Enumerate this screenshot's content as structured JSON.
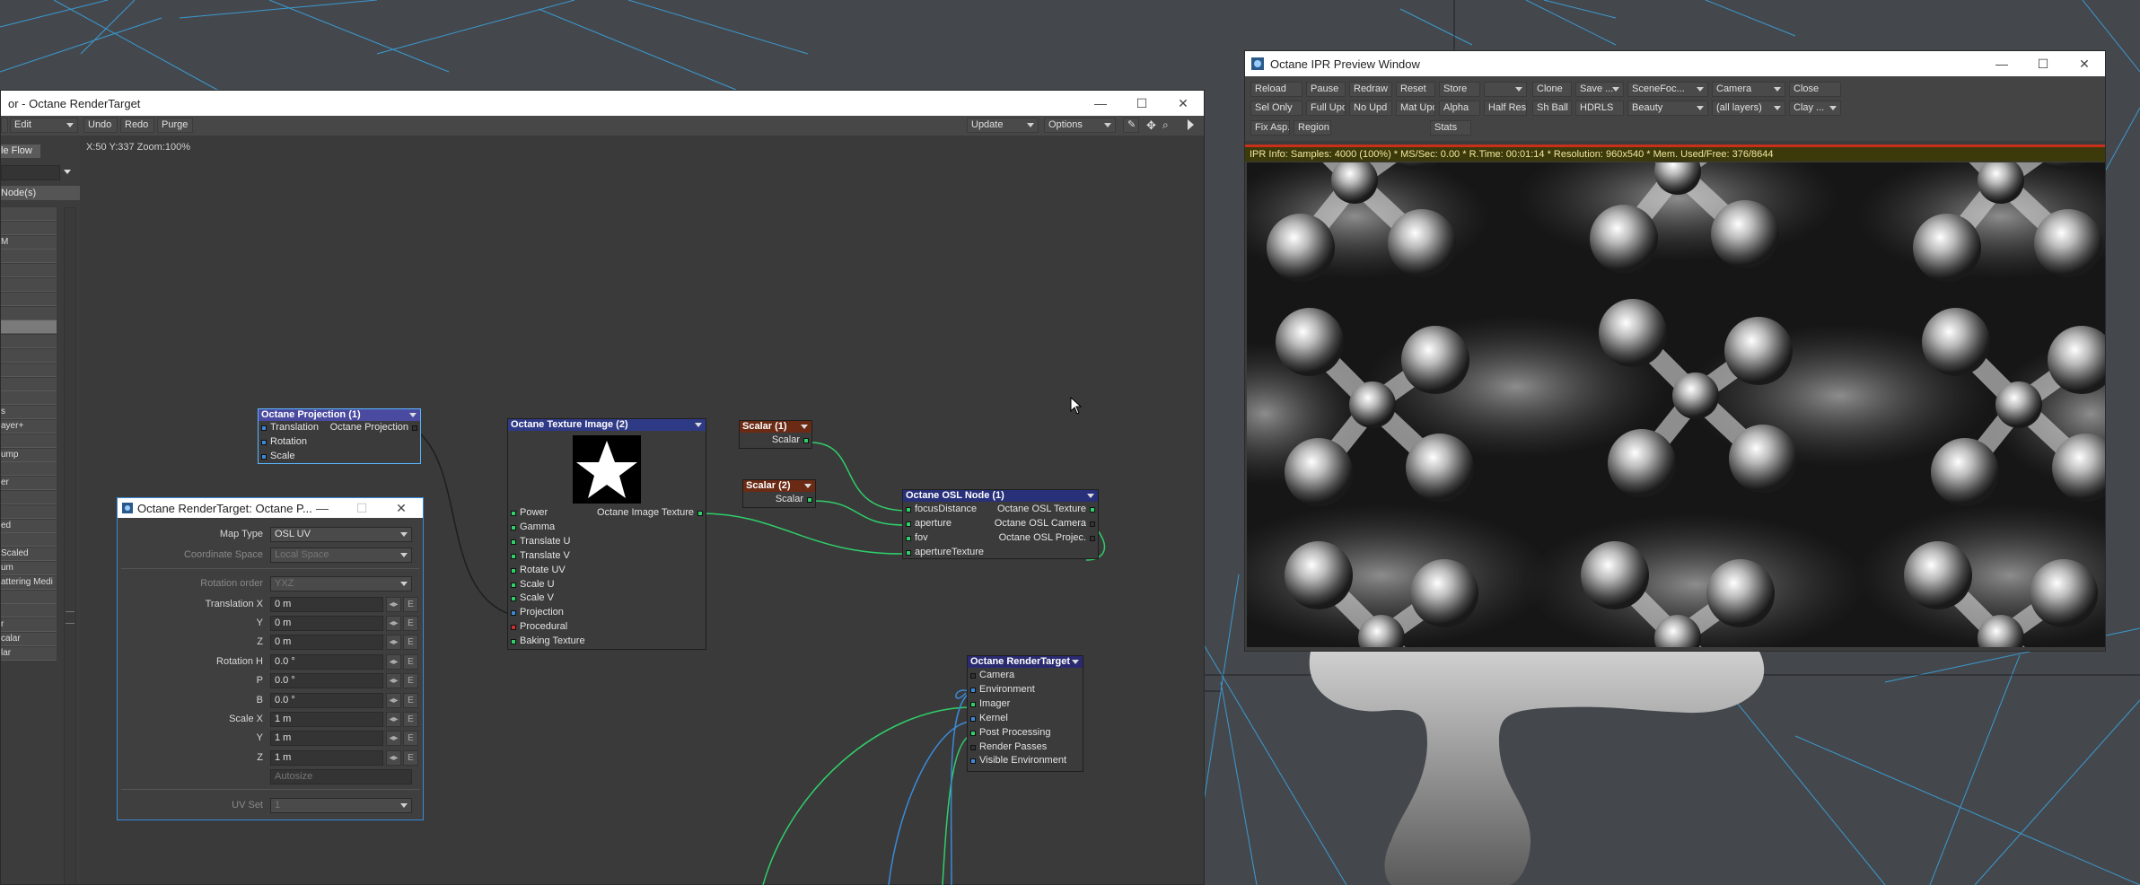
{
  "node_editor": {
    "title": "or - Octane RenderTarget",
    "menus": {
      "edit": "Edit"
    },
    "toolbar": {
      "undo": "Undo",
      "redo": "Redo",
      "purge": "Purge",
      "update": "Update",
      "options": "Options"
    },
    "status": "X:50 Y:337 Zoom:100%",
    "left_panel": {
      "tab": "le Flow",
      "header": "Node(s)",
      "items": [
        "",
        "",
        "M",
        "",
        "",
        "",
        "",
        "",
        "",
        "",
        "",
        "",
        "",
        "",
        "s",
        "ayer+",
        "",
        "ump",
        "",
        "er",
        "",
        "",
        "ed",
        "",
        "Scaled",
        "um",
        "attering Medi",
        "",
        "",
        "r",
        "calar",
        "lar"
      ]
    }
  },
  "nodes": {
    "projection": {
      "title": "Octane Projection (1)",
      "inputs": [
        "Translation",
        "Rotation",
        "Scale"
      ],
      "output": "Octane Projection"
    },
    "texture": {
      "title": "Octane Texture Image (2)",
      "inputs": [
        "Power",
        "Gamma",
        "Translate U",
        "Translate V",
        "Rotate UV",
        "Scale U",
        "Scale V",
        "Projection",
        "Procedural",
        "Baking Texture"
      ],
      "output": "Octane Image Texture"
    },
    "scalar1": {
      "title": "Scalar (1)",
      "output": "Scalar"
    },
    "scalar2": {
      "title": "Scalar (2)",
      "output": "Scalar"
    },
    "osl": {
      "title": "Octane OSL Node (1)",
      "inputs": [
        "focusDistance",
        "aperture",
        "fov",
        "apertureTexture"
      ],
      "outputs": [
        "Octane OSL Texture",
        "Octane OSL Camera",
        "Octane OSL Projec."
      ]
    },
    "rendertarget": {
      "title": "Octane RenderTarget",
      "inputs": [
        "Camera",
        "Environment",
        "Imager",
        "Kernel",
        "Post Processing",
        "Render Passes",
        "Visible Environment"
      ]
    }
  },
  "props_panel": {
    "title": "Octane RenderTarget: Octane P...",
    "fields": [
      {
        "label": "Map Type",
        "value": "OSL UV",
        "dropdown": true,
        "enabled": true
      },
      {
        "label": "Coordinate Space",
        "value": "Local Space",
        "dropdown": true,
        "enabled": false
      },
      {
        "label": "Rotation order",
        "value": "YXZ",
        "dropdown": true,
        "enabled": false
      },
      {
        "label": "Translation X",
        "value": "0 m",
        "enabled": true,
        "env": true
      },
      {
        "label": "Y",
        "value": "0 m",
        "enabled": true,
        "env": true
      },
      {
        "label": "Z",
        "value": "0 m",
        "enabled": true,
        "env": true
      },
      {
        "label": "Rotation H",
        "value": "0.0 °",
        "enabled": true,
        "env": true
      },
      {
        "label": "P",
        "value": "0.0 °",
        "enabled": true,
        "env": true
      },
      {
        "label": "B",
        "value": "0.0 °",
        "enabled": true,
        "env": true
      },
      {
        "label": "Scale X",
        "value": "1 m",
        "enabled": true,
        "env": true
      },
      {
        "label": "Y",
        "value": "1 m",
        "enabled": true,
        "env": true
      },
      {
        "label": "Z",
        "value": "1 m",
        "enabled": true,
        "env": true
      },
      {
        "label": "",
        "value": "Autosize",
        "enabled": false
      },
      {
        "label": "UV Set",
        "value": "1",
        "dropdown": true,
        "enabled": false
      }
    ]
  },
  "ipr": {
    "title": "Octane IPR Preview Window",
    "row1": [
      {
        "label": "Reload"
      },
      {
        "label": "Pause"
      },
      {
        "label": "Redraw"
      },
      {
        "label": "Reset"
      },
      {
        "label": "Store"
      },
      {
        "label": "",
        "dropdown": true
      },
      {
        "label": "Clone"
      },
      {
        "label": "Save ...",
        "dropdown": true
      },
      {
        "label": "SceneFoc...",
        "dropdown": true
      },
      {
        "label": "Camera",
        "dropdown": true
      },
      {
        "label": "Close"
      }
    ],
    "row2": [
      {
        "label": "Sel Only"
      },
      {
        "label": "Full Upd."
      },
      {
        "label": "No Upd"
      },
      {
        "label": "Mat Upd"
      },
      {
        "label": "Alpha"
      },
      {
        "label": "Half Res"
      },
      {
        "label": "Sh Ball"
      },
      {
        "label": "HDRLS"
      },
      {
        "label": "Beauty",
        "dropdown": true
      },
      {
        "label": "(all layers)",
        "dropdown": true
      },
      {
        "label": "Clay ...",
        "dropdown": true
      }
    ],
    "row3": [
      {
        "label": "Fix Asp."
      },
      {
        "label": "Region"
      },
      {
        "label": "Stats"
      }
    ],
    "info": "IPR Info:  Samples: 4000 (100%)  *  MS/Sec: 0.00  *  R.Time: 00:01:14  *  Resolution: 960x540  *  Mem. Used/Free: 376/8644"
  },
  "window_controls": {
    "minimize": "—",
    "maximize": "☐",
    "close": "✕"
  },
  "colors": {
    "projection_header": "#4a4aa0",
    "texture_header": "#2f3a86",
    "scalar_header": "#6a2a14",
    "osl_header": "#28307a",
    "rendertarget_header": "#2a2a70",
    "wire_green": "#2fcf6a",
    "wire_blue": "#3a8ad8",
    "info_bar": "#3c3a0a"
  }
}
